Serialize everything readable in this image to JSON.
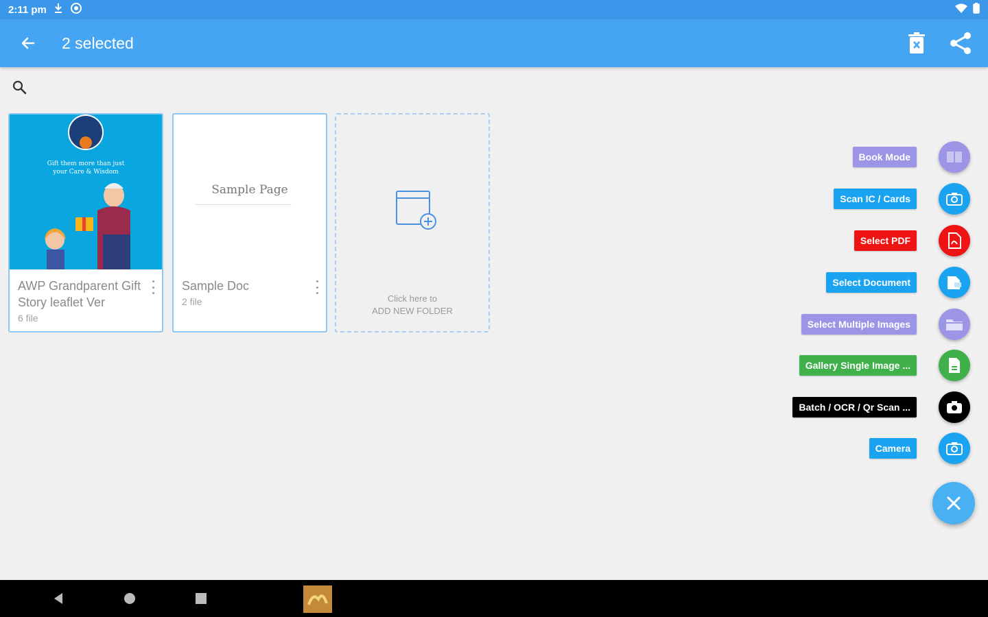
{
  "status_bar": {
    "time": "2:11 pm",
    "icons": [
      "download-icon",
      "sync-icon",
      "wifi-icon",
      "battery-icon"
    ]
  },
  "app_bar": {
    "title": "2 selected",
    "back_icon": "arrow-left-icon",
    "actions": [
      "trash-icon",
      "share-icon"
    ]
  },
  "search": {
    "icon": "search-icon"
  },
  "folders": [
    {
      "name": "AWP Grandparent Gift Story leaflet Ver",
      "count": "6 file",
      "thumbnail_text": "Gift them more than just your Care & Wisdom"
    },
    {
      "name": "Sample Doc",
      "count": "2 file",
      "thumbnail_text": "Sample Page"
    }
  ],
  "add_folder": {
    "line1": "Click here to",
    "line2": "ADD NEW FOLDER"
  },
  "fab_menu": [
    {
      "label": "Book Mode",
      "icon": "book-icon",
      "color": "#9c95e6"
    },
    {
      "label": "Scan IC / Cards",
      "icon": "camera-icon",
      "color": "#1aa3f0"
    },
    {
      "label": "Select PDF",
      "icon": "pdf-icon",
      "color": "#f01313"
    },
    {
      "label": "Select Document",
      "icon": "document-icon",
      "color": "#1aa3f0"
    },
    {
      "label": "Select Multiple Images",
      "icon": "folder-icon",
      "color": "#9c95e6"
    },
    {
      "label": "Gallery Single Image ...",
      "icon": "file-icon",
      "color": "#3fb04a"
    },
    {
      "label": "Batch / OCR / Qr Scan ...",
      "icon": "camera-icon",
      "color": "#000000"
    },
    {
      "label": "Camera",
      "icon": "camera-icon",
      "color": "#1aa3f0"
    }
  ],
  "fab_main": {
    "icon": "close-icon",
    "color": "#4ab0f4"
  },
  "nav_bar": {
    "buttons": [
      "back-triangle-icon",
      "home-circle-icon",
      "recents-square-icon"
    ]
  }
}
